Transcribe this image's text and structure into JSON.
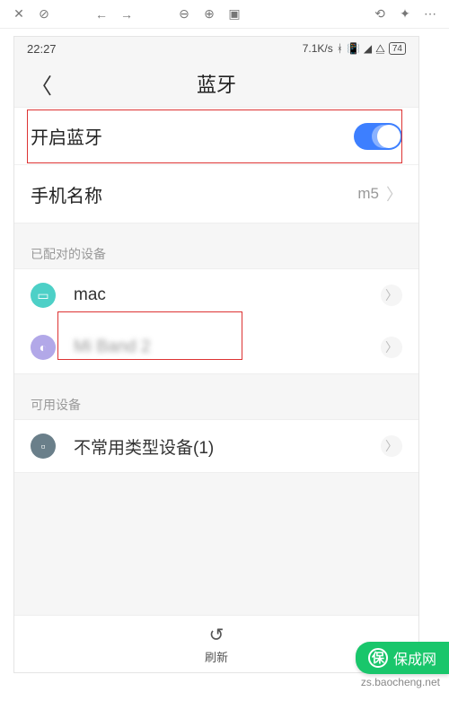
{
  "browser_toolbar": {
    "close_icon": "close",
    "stop_icon": "stop",
    "back_icon": "back",
    "forward_icon": "forward",
    "zoom_out_icon": "zoom-out",
    "zoom_in_icon": "zoom-in",
    "fit_icon": "fit",
    "refresh_icon": "refresh",
    "tools_icon": "tools",
    "more_icon": "more"
  },
  "status": {
    "time": "22:27",
    "net_speed": "7.1K/s",
    "battery_text": "74"
  },
  "header": {
    "title": "蓝牙"
  },
  "rows": {
    "enable_bt": "开启蓝牙",
    "phone_name_label": "手机名称",
    "phone_name_value": "m5"
  },
  "sections": {
    "paired_header": "已配对的设备",
    "available_header": "可用设备"
  },
  "paired_devices": [
    {
      "name": "mac",
      "icon": "laptop"
    },
    {
      "name": "Mi Band 2",
      "icon": "wearable",
      "blurred": true
    }
  ],
  "available_devices": [
    {
      "name": "不常用类型设备(1)",
      "icon": "other"
    }
  ],
  "refresh": {
    "label": "刷新"
  },
  "watermark": {
    "text": "保成网",
    "url": "zs.baocheng.net"
  }
}
